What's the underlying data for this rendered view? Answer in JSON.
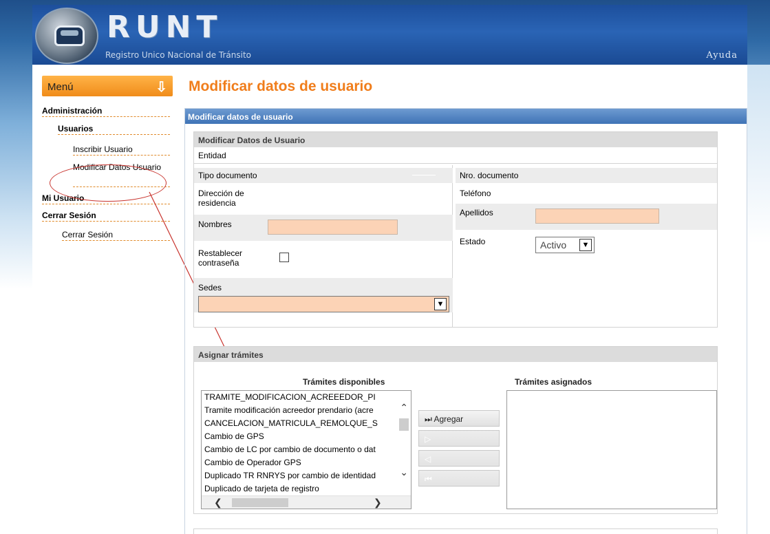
{
  "header": {
    "logo_text": "RUNT",
    "subtitle": "Registro Unico Nacional de Tránsito",
    "help": "Ayuda"
  },
  "sidebar": {
    "menu_label": "Menú",
    "items": [
      {
        "label": "Administración"
      },
      {
        "label": "Usuarios"
      },
      {
        "label": "Inscribir Usuario"
      },
      {
        "label": "Modificar Datos Usuario"
      },
      {
        "label": "Mi Usuario"
      },
      {
        "label": "Cerrar Sesión"
      },
      {
        "label": "Cerrar Sesión"
      }
    ]
  },
  "main": {
    "page_title": "Modificar datos de usuario",
    "panel_title": "Modificar datos de usuario",
    "section_title": "Modificar Datos de Usuario",
    "entidad_label": "Entidad",
    "fields": {
      "tipo_documento": "Tipo documento",
      "direccion": "Dirección de residencia",
      "nombres": "Nombres",
      "restablecer": "Restablecer contraseña",
      "sedes": "Sedes",
      "nro_documento": "Nro. documento",
      "telefono": "Teléfono",
      "apellidos": "Apellidos",
      "estado": "Estado",
      "estado_value": "Activo",
      "nombres_value": "",
      "apellidos_value": ""
    },
    "asignar": {
      "title": "Asignar trámites",
      "disponibles_label": "Trámites disponibles",
      "asignados_label": "Trámites asignados",
      "disponibles": [
        "TRAMITE_MODIFICACION_ACREEEDOR_PI",
        "Tramite modificación acreedor prendario (acre",
        "CANCELACION_MATRICULA_REMOLQUE_S",
        "Cambio de GPS",
        "Cambio de LC por cambio de documento o dat",
        "Cambio de Operador GPS",
        "Duplicado TR RNRYS por cambio de identidad",
        "Duplicado de tarjeta de registro"
      ],
      "asignados": [],
      "buttons": {
        "agregar": "⏭ Agregar",
        "b2": "▷",
        "b3": "◁",
        "b4": "⏮"
      }
    }
  },
  "colors": {
    "accent_orange": "#f07d1b",
    "header_blue": "#2a64b5",
    "panel_blue": "#3f73b6",
    "input_orange": "#fcd3b6",
    "annotation_red": "#c8332d"
  },
  "icons": {
    "menu_arrow": "arrow-down-icon",
    "select_arrow": "chevron-down-icon"
  }
}
